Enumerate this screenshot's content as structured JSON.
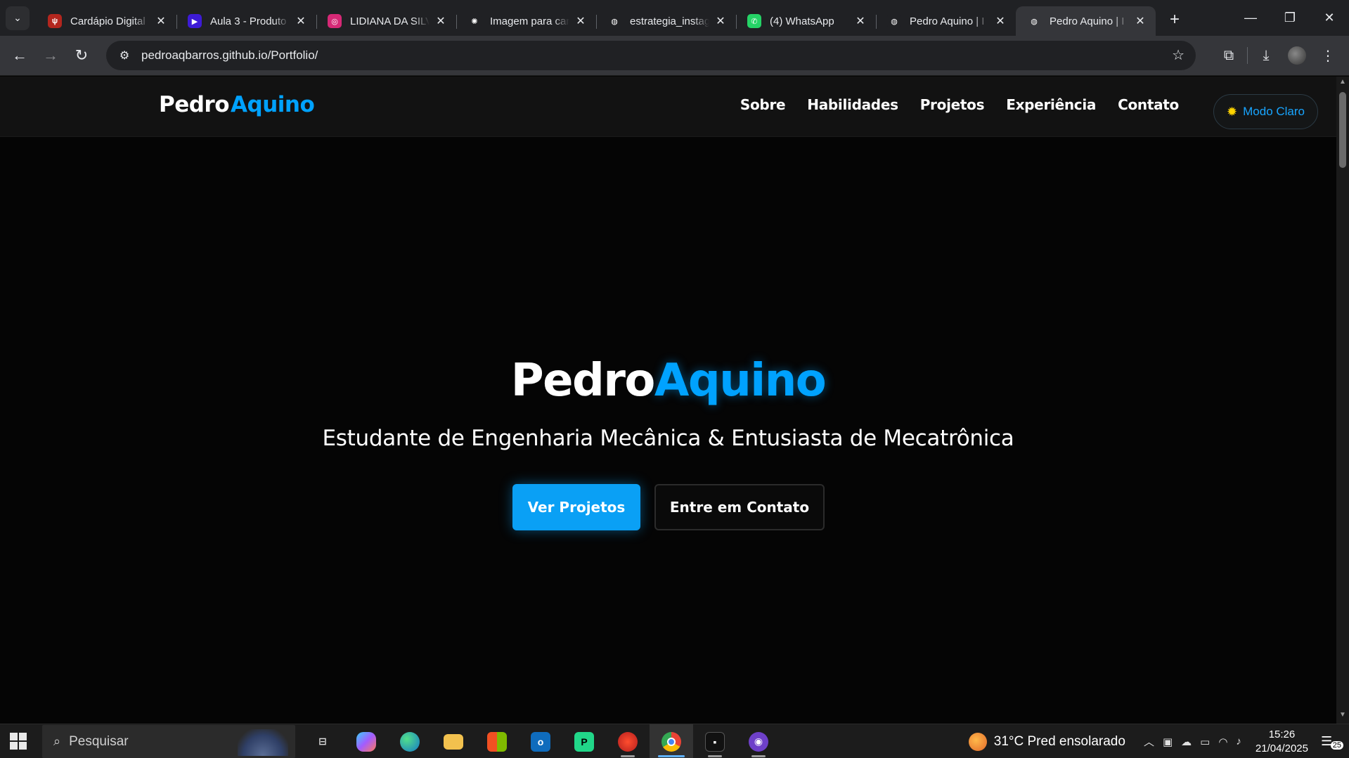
{
  "browser": {
    "tabs": [
      {
        "title": "Cardápio Digital",
        "favicon": "menu-icon",
        "color": "#b3261e",
        "glyph": "ψ"
      },
      {
        "title": "Aula 3 - Produto",
        "favicon": "video-icon",
        "color": "#3d1bd6",
        "glyph": "▶"
      },
      {
        "title": "LIDIANA DA SILV",
        "favicon": "instagram-icon",
        "color": "#d62976",
        "glyph": "◎"
      },
      {
        "title": "Imagem para car",
        "favicon": "openai-icon",
        "color": "#202124",
        "glyph": "✺"
      },
      {
        "title": "estrategia_instag",
        "favicon": "globe-icon",
        "color": "#202124",
        "glyph": "◍"
      },
      {
        "title": "(4) WhatsApp",
        "favicon": "whatsapp-icon",
        "color": "#25d366",
        "glyph": "✆"
      },
      {
        "title": "Pedro Aquino | I",
        "favicon": "globe-icon",
        "color": "#202124",
        "glyph": "◍"
      },
      {
        "title": "Pedro Aquino | I",
        "favicon": "globe-icon",
        "color": "#35363a",
        "glyph": "◍",
        "active": true
      }
    ],
    "url_host": "pedroaqbarros.github.io",
    "url_path": "/Portfolio/"
  },
  "site": {
    "logo_first": "Pedro",
    "logo_last": "Aquino",
    "nav": [
      "Sobre",
      "Habilidades",
      "Projetos",
      "Experiência",
      "Contato"
    ],
    "mode_button": "Modo Claro",
    "hero_first": "Pedro",
    "hero_last": "Aquino",
    "hero_subtitle": "Estudante de Engenharia Mecânica & Entusiasta de Mecatrônica",
    "primary_button": "Ver Projetos",
    "secondary_button": "Entre em Contato",
    "accent_color": "#00a2ff"
  },
  "taskbar": {
    "search_placeholder": "Pesquisar",
    "weather": "31°C  Pred ensolarado",
    "time": "15:26",
    "date": "21/04/2025",
    "notifications": "25"
  }
}
